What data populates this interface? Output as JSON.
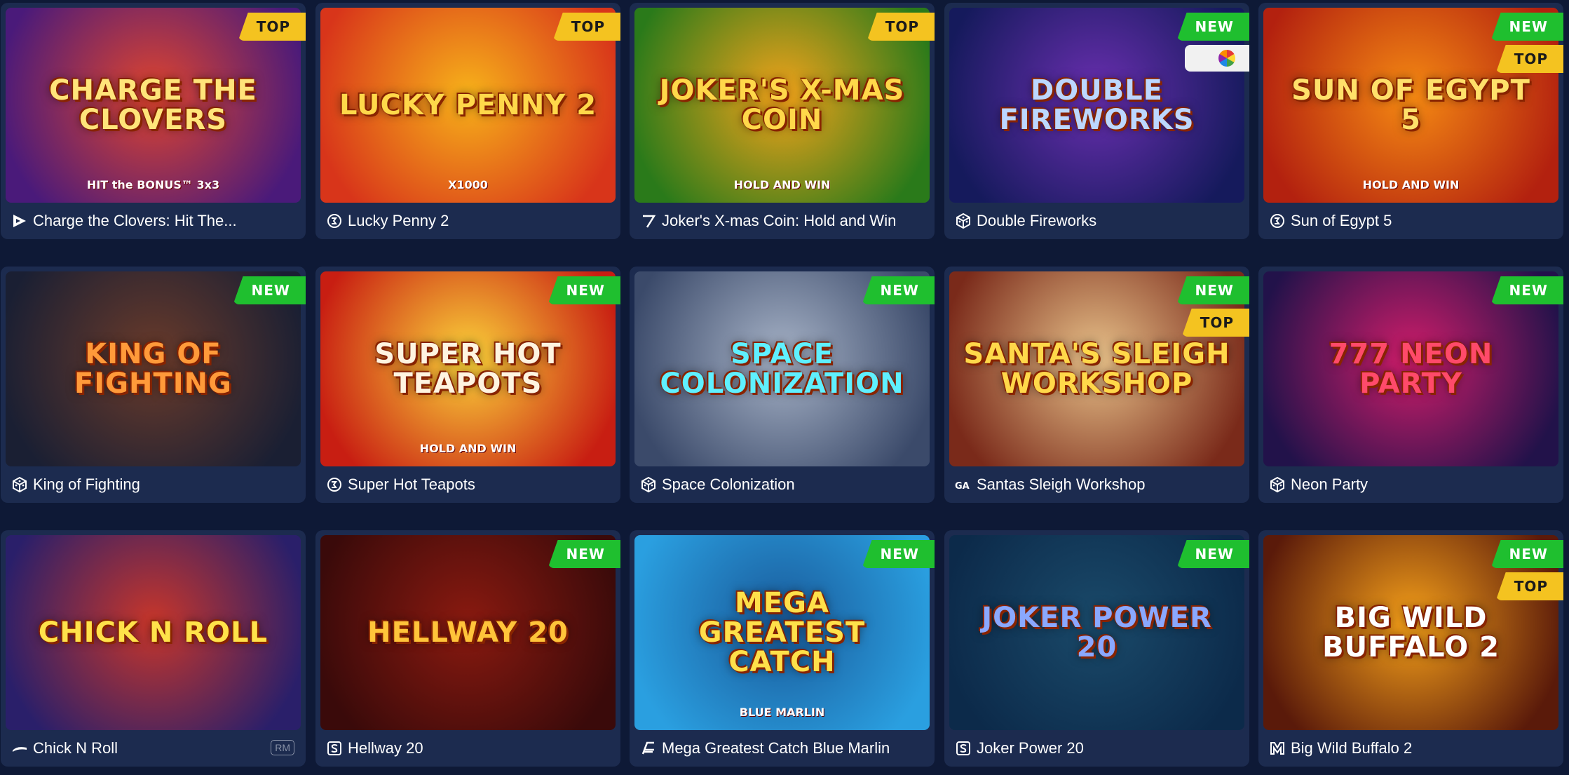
{
  "games": [
    {
      "name": "Charge the Clovers: Hit The...",
      "art": "CHARGE THE CLOVERS",
      "art_sub": "HIT the BONUS™ 3x3",
      "bg": [
        "#4a1a7a",
        "#e0452e"
      ],
      "art_color": "#ffe47a",
      "provider_icon": "play-triangle-icon",
      "badges": [
        {
          "label": "TOP",
          "type": "top"
        }
      ]
    },
    {
      "name": "Lucky Penny 2",
      "art": "LUCKY PENNY 2",
      "art_sub": "X1000",
      "bg": [
        "#d8351a",
        "#f7b21a"
      ],
      "art_color": "#ffd84a",
      "provider_icon": "3oaks-icon",
      "badges": [
        {
          "label": "TOP",
          "type": "top"
        }
      ]
    },
    {
      "name": "Joker's X-mas Coin: Hold and Win",
      "art": "JOKER'S X-MAS COIN",
      "art_sub": "HOLD AND WIN",
      "bg": [
        "#2a7a1a",
        "#f3a31b"
      ],
      "art_color": "#ffd84a",
      "provider_icon": "seven-icon",
      "badges": [
        {
          "label": "TOP",
          "type": "top"
        }
      ]
    },
    {
      "name": "Double Fireworks",
      "art": "DOUBLE FIREWORKS",
      "art_sub": "",
      "bg": [
        "#151a5c",
        "#6a2fb0"
      ],
      "art_color": "#bcd7ff",
      "provider_icon": "dice-icon",
      "badges": [
        {
          "label": "NEW",
          "type": "new"
        }
      ],
      "chip": true
    },
    {
      "name": "Sun of Egypt 5",
      "art": "SUN OF EGYPT 5",
      "art_sub": "HOLD AND WIN",
      "bg": [
        "#b3210f",
        "#f58a13"
      ],
      "art_color": "#ffe06a",
      "provider_icon": "3oaks-icon",
      "badges": [
        {
          "label": "NEW",
          "type": "new"
        },
        {
          "label": "TOP",
          "type": "top"
        }
      ]
    },
    {
      "name": "King of Fighting",
      "art": "KING OF FIGHTING",
      "art_sub": "",
      "bg": [
        "#1a1f33",
        "#6b3b2a"
      ],
      "art_color": "#ff9a3a",
      "provider_icon": "dice-icon",
      "badges": [
        {
          "label": "NEW",
          "type": "new"
        }
      ]
    },
    {
      "name": "Super Hot Teapots",
      "art": "SUPER HOT TEAPOTS",
      "art_sub": "HOLD AND WIN",
      "bg": [
        "#c81e12",
        "#fbd43a"
      ],
      "art_color": "#fff4e0",
      "provider_icon": "3oaks-icon",
      "badges": [
        {
          "label": "NEW",
          "type": "new"
        }
      ]
    },
    {
      "name": "Space Colonization",
      "art": "SPACE COLONIZATION",
      "art_sub": "",
      "bg": [
        "#3b4a6a",
        "#a7b3c7"
      ],
      "art_color": "#5ff0ff",
      "provider_icon": "dice-icon",
      "badges": [
        {
          "label": "NEW",
          "type": "new"
        }
      ]
    },
    {
      "name": "Santas Sleigh Workshop",
      "art": "SANTA'S SLEIGH WORKSHOP",
      "art_sub": "",
      "bg": [
        "#7a2a1a",
        "#e8c28a"
      ],
      "art_color": "#ffd84a",
      "provider_icon": "ga-icon",
      "badges": [
        {
          "label": "NEW",
          "type": "new"
        },
        {
          "label": "TOP",
          "type": "top"
        }
      ]
    },
    {
      "name": "Neon Party",
      "art": "777 NEON PARTY",
      "art_sub": "",
      "bg": [
        "#22124a",
        "#d01d6a"
      ],
      "art_color": "#ff4a6a",
      "provider_icon": "dice-icon",
      "badges": [
        {
          "label": "NEW",
          "type": "new"
        }
      ]
    },
    {
      "name": "Chick N Roll",
      "art": "CHICK N ROLL",
      "art_sub": "",
      "bg": [
        "#2a1f6a",
        "#c8362a"
      ],
      "art_color": "#ffe24a",
      "provider_icon": "wave-icon",
      "badges": [],
      "rm": "RM"
    },
    {
      "name": "Hellway 20",
      "art": "HELLWAY 20",
      "art_sub": "",
      "bg": [
        "#3a0a0a",
        "#8a1a10"
      ],
      "art_color": "#ffc43a",
      "provider_icon": "s-icon",
      "badges": [
        {
          "label": "NEW",
          "type": "new"
        }
      ]
    },
    {
      "name": "Mega Greatest Catch Blue Marlin",
      "art": "MEGA GREATEST CATCH",
      "art_sub": "BLUE MARLIN",
      "bg": [
        "#2a9fe0",
        "#1a5a9a"
      ],
      "art_color": "#ffe04a",
      "provider_icon": "stripes-icon",
      "badges": [
        {
          "label": "NEW",
          "type": "new"
        }
      ]
    },
    {
      "name": "Joker Power 20",
      "art": "JOKER POWER 20",
      "art_sub": "",
      "bg": [
        "#0c2a4a",
        "#1a4a6a"
      ],
      "art_color": "#8aa8ff",
      "provider_icon": "s-icon",
      "badges": [
        {
          "label": "NEW",
          "type": "new"
        }
      ]
    },
    {
      "name": "Big Wild Buffalo 2",
      "art": "BIG WILD BUFFALO 2",
      "art_sub": "",
      "bg": [
        "#5a1a0a",
        "#f5a01a"
      ],
      "art_color": "#ffffff",
      "provider_icon": "m-icon",
      "badges": [
        {
          "label": "NEW",
          "type": "new"
        },
        {
          "label": "TOP",
          "type": "top"
        }
      ]
    }
  ]
}
